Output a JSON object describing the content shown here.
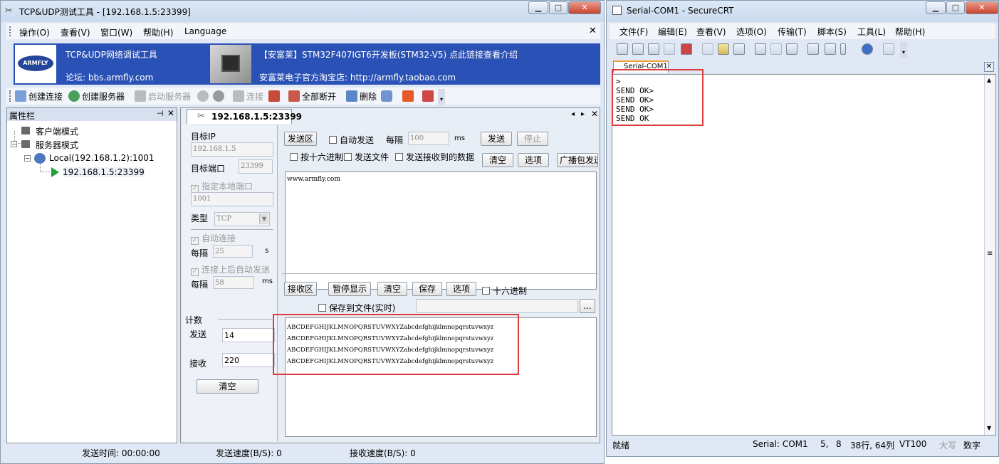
{
  "tcp": {
    "title": "TCP&UDP测试工具 - [192.168.1.5:23399]",
    "menu": [
      "操作(O)",
      "查看(V)",
      "窗口(W)",
      "帮助(H)",
      "Language"
    ],
    "banner": {
      "logo": "ARMFLY",
      "left_title": "TCP&UDP网络调试工具",
      "left_forum": "论坛: bbs.armfly.com",
      "right_line1": "【安富莱】STM32F407IGT6开发板(STM32-V5) 点此链接查看介绍",
      "right_line2": "安富莱电子官方淘宝店: http://armfly.taobao.com"
    },
    "toolbar": {
      "create_conn": "创建连接",
      "create_server": "创建服务器",
      "start_server": "启动服务器",
      "connect": "连接",
      "disconnect_all": "全部断开",
      "delete": "删除"
    },
    "sidebar": {
      "title": "属性栏",
      "pin": "ᵖ",
      "tree": [
        "客户端模式",
        "服务器模式",
        "Local(192.168.1.2):1001",
        "192.168.1.5:23399"
      ]
    },
    "tab": {
      "label": "192.168.1.5:23399"
    },
    "props": {
      "target_ip_label": "目标IP",
      "target_ip": "192.168.1.5",
      "target_port_label": "目标端口",
      "target_port": "23399",
      "local_port_label": "指定本地端口",
      "local_port": "1001",
      "type_label": "类型",
      "type_value": "TCP",
      "auto_conn_label": "自动连接",
      "interval_label": "每隔",
      "interval1": "25",
      "unit_s": "s",
      "auto_send_label": "连接上后自动发送",
      "interval2": "58",
      "unit_ms": "ms",
      "count_label": "计数",
      "send_label": "发送",
      "send_count": "14",
      "recv_label": "接收",
      "recv_count": "220",
      "clear": "清空"
    },
    "send": {
      "area_label": "发送区",
      "auto_send": "自动发送",
      "interval_label": "每隔",
      "interval": "100",
      "unit": "ms",
      "send_btn": "发送",
      "stop_btn": "停止",
      "hex_send": "按十六进制",
      "send_file": "发送文件",
      "send_received": "发送接收到的数据",
      "clear_btn": "清空",
      "options_btn": "选项",
      "broadcast_btn": "广播包发送",
      "content": "www.armfly.com"
    },
    "recv": {
      "area_label": "接收区",
      "pause_btn": "暂停显示",
      "clear_btn": "清空",
      "save_btn": "保存",
      "options_btn": "选项",
      "hex": "十六进制",
      "save_to_file": "保存到文件(实时)",
      "browse": "...",
      "lines": [
        "ABCDEFGHIJKLMNOPQRSTUVWXYZabcdefghijklmnopqrstuvwxyz",
        "ABCDEFGHIJKLMNOPQRSTUVWXYZabcdefghijklmnopqrstuvwxyz",
        "ABCDEFGHIJKLMNOPQRSTUVWXYZabcdefghijklmnopqrstuvwxyz",
        "ABCDEFGHIJKLMNOPQRSTUVWXYZabcdefghijklmnopqrstuvwxyz"
      ]
    },
    "status": {
      "send_time": "发送时间: 00:00:00",
      "send_speed": "发送速度(B/S): 0",
      "recv_speed": "接收速度(B/S): 0"
    }
  },
  "crt": {
    "title": "Serial-COM1 - SecureCRT",
    "menu": [
      "文件(F)",
      "编辑(E)",
      "查看(V)",
      "选项(O)",
      "传输(T)",
      "脚本(S)",
      "工具(L)",
      "帮助(H)"
    ],
    "tab": "Serial-COM1",
    "terminal_lines": [
      ">",
      "SEND OK>",
      "SEND OK>",
      "SEND OK>",
      "SEND OK"
    ],
    "status": {
      "ready": "就绪",
      "port": "Serial: COM1",
      "row": "5,",
      "col": "8",
      "size": "38行, 64列",
      "term": "VT100",
      "caps": "大写",
      "num": "数字"
    }
  },
  "colors": {
    "highlight_box": "#e03b3b",
    "banner_bg": "#2a51b5",
    "title_bg": "#c9daee"
  }
}
